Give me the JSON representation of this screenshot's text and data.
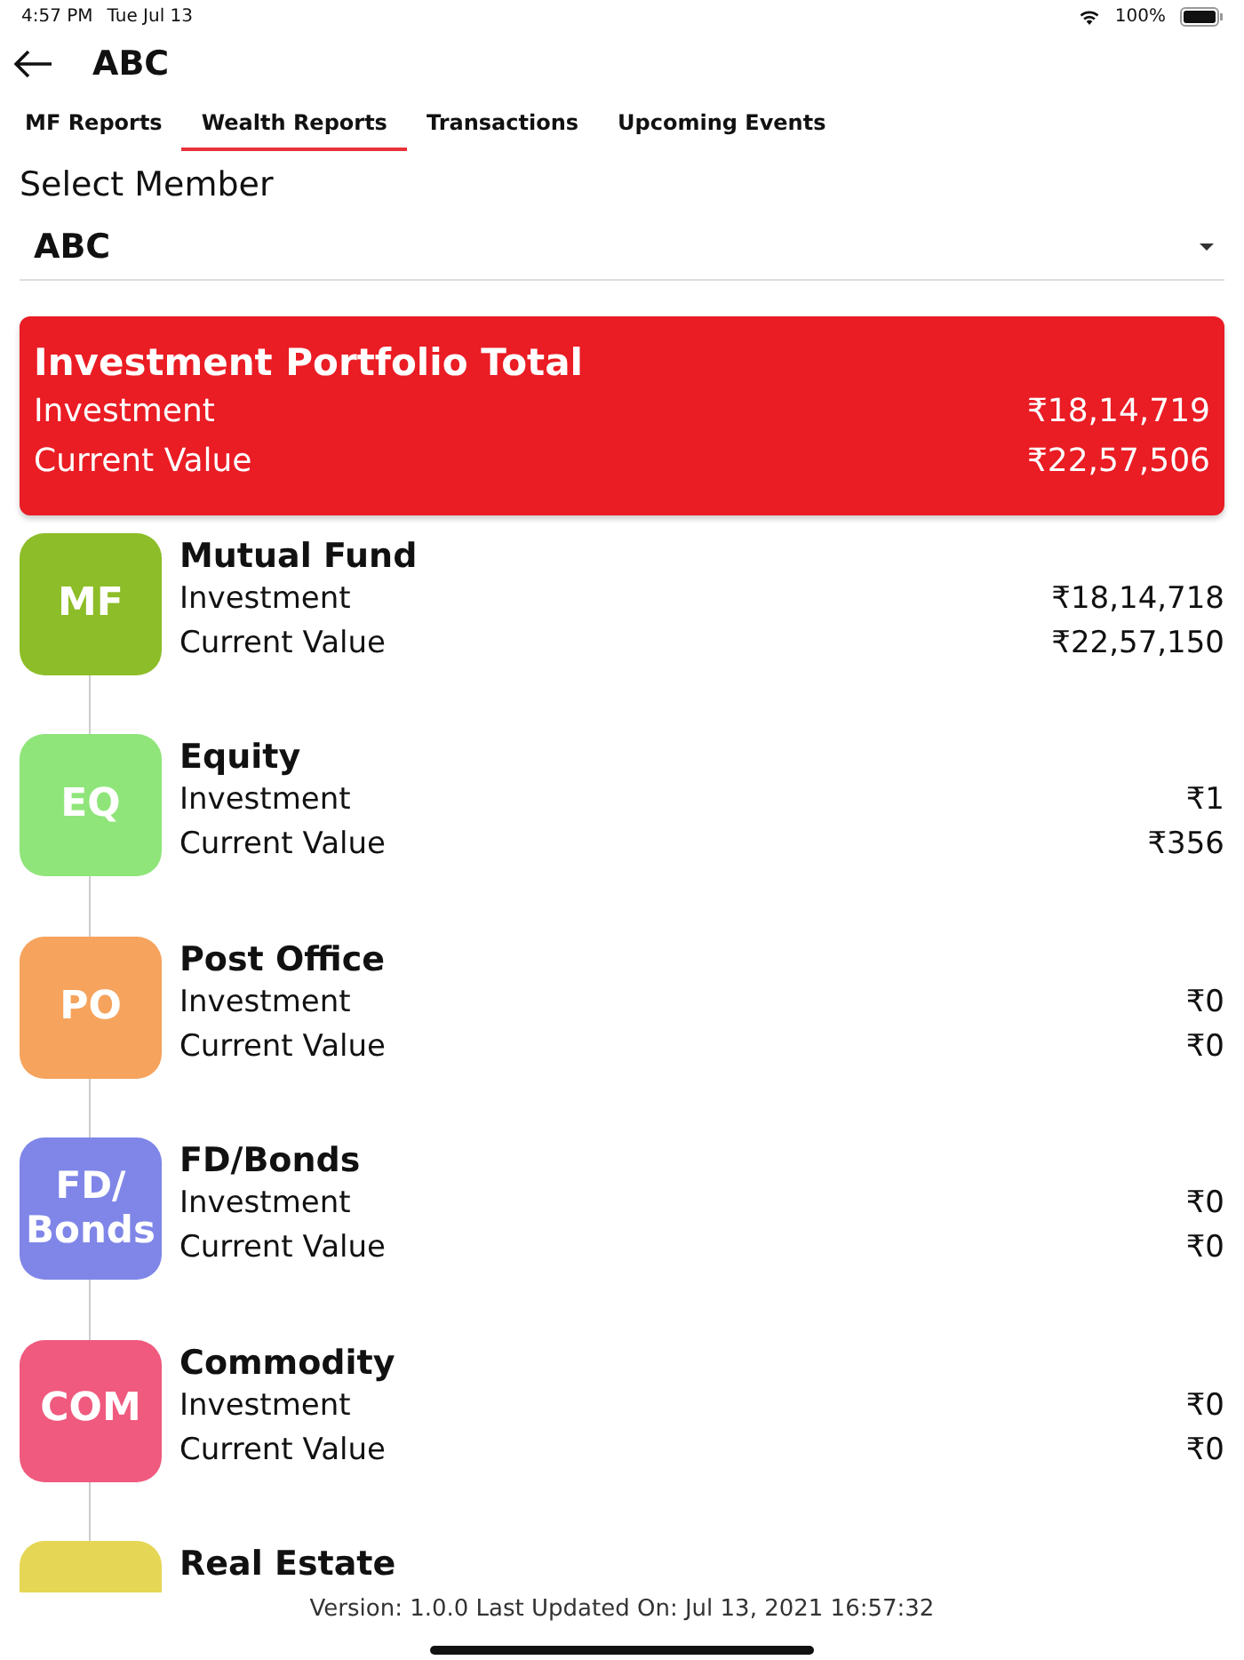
{
  "status_bar": {
    "time": "4:57 PM",
    "date": "Tue Jul 13",
    "battery": "100%"
  },
  "header": {
    "title": "ABC"
  },
  "tabs": [
    {
      "label": "MF Reports",
      "selected": false
    },
    {
      "label": "Wealth Reports",
      "selected": true
    },
    {
      "label": "Transactions",
      "selected": false
    },
    {
      "label": "Upcoming Events",
      "selected": false
    }
  ],
  "member_select": {
    "label": "Select Member",
    "value": "ABC"
  },
  "total_card": {
    "title": "Investment Portfolio Total",
    "investment_label": "Investment",
    "investment": "₹18,14,719",
    "current_label": "Current Value",
    "current": "₹22,57,506"
  },
  "assets": [
    {
      "badge": "MF",
      "color": "#8dbd28",
      "name": "Mutual Fund",
      "investment_label": "Investment",
      "investment": "₹18,14,718",
      "current_label": "Current Value",
      "current": "₹22,57,150"
    },
    {
      "badge": "EQ",
      "color": "#8fe57a",
      "name": "Equity",
      "investment_label": "Investment",
      "investment": "₹1",
      "current_label": "Current Value",
      "current": "₹356"
    },
    {
      "badge": "PO",
      "color": "#f5a35d",
      "name": "Post Office",
      "investment_label": "Investment",
      "investment": "₹0",
      "current_label": "Current Value",
      "current": "₹0"
    },
    {
      "badge": "FD/ Bonds",
      "color": "#7f86e8",
      "name": "FD/Bonds",
      "investment_label": "Investment",
      "investment": "₹0",
      "current_label": "Current Value",
      "current": "₹0"
    },
    {
      "badge": "COM",
      "color": "#ef5a7e",
      "name": "Commodity",
      "investment_label": "Investment",
      "investment": "₹0",
      "current_label": "Current Value",
      "current": "₹0"
    },
    {
      "color": "#e6d656",
      "name": "Real Estate"
    }
  ],
  "footer": "Version: 1.0.0 Last Updated On: Jul 13, 2021 16:57:32"
}
